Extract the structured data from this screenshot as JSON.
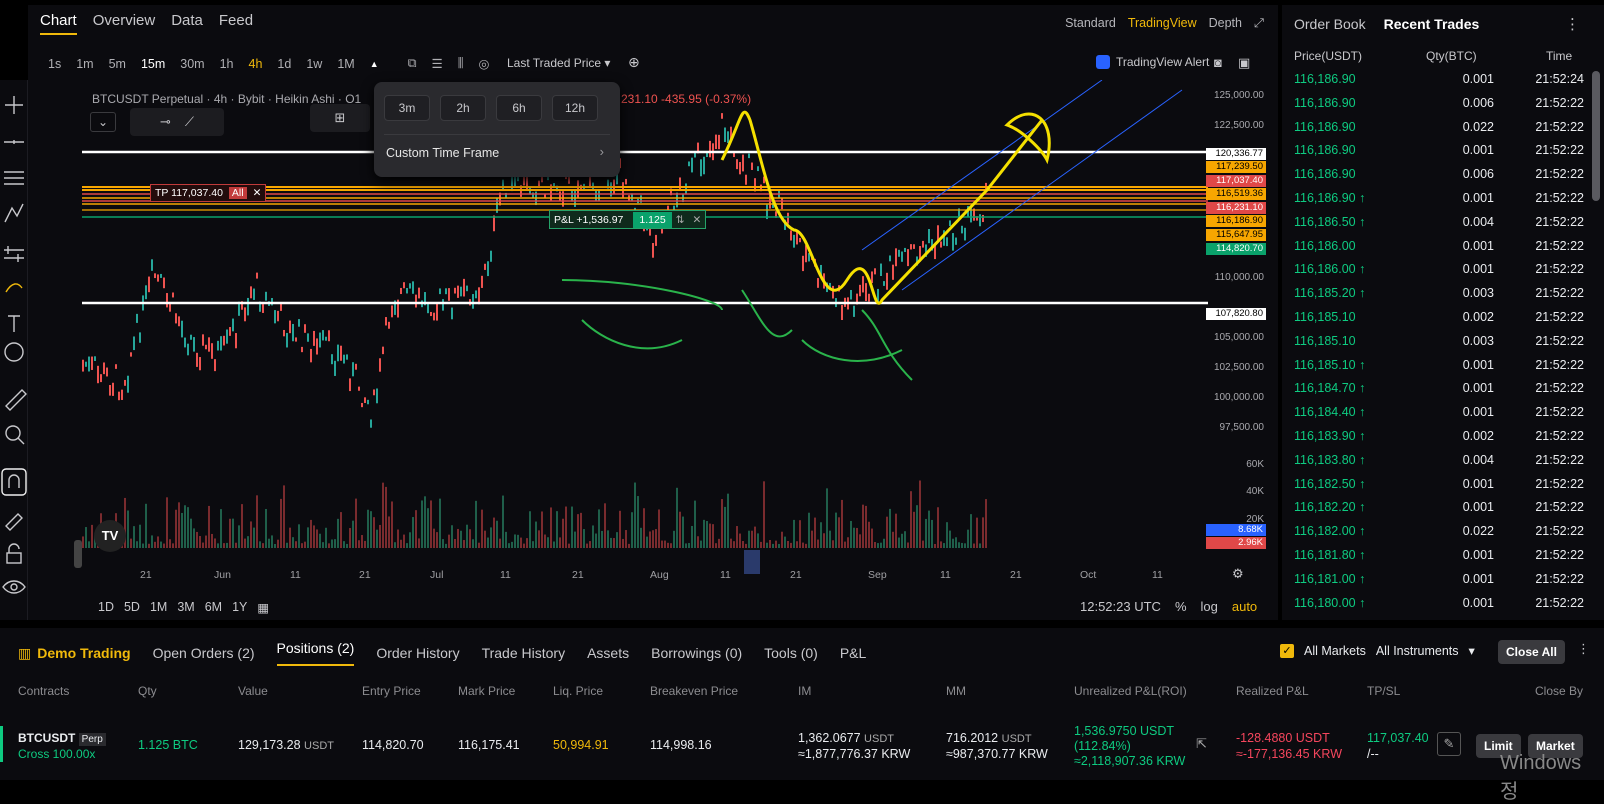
{
  "chart_tabs": [
    "Chart",
    "Overview",
    "Data",
    "Feed"
  ],
  "view_modes": [
    "Standard",
    "TradingView",
    "Depth"
  ],
  "timeframes": [
    "1s",
    "1m",
    "5m",
    "15m",
    "30m",
    "1h",
    "4h",
    "1d",
    "1w",
    "1M"
  ],
  "price_source": "Last Traded Price",
  "tv_alert": "TradingView Alert",
  "symbol_line": "BTCUSDT Perpetual · 4h · Bybit · Heikin Ashi · O1",
  "symbol_change": "231.10 -435.95 (-0.37%)",
  "tf_menu": {
    "options": [
      "3m",
      "2h",
      "6h",
      "12h"
    ],
    "custom": "Custom Time Frame"
  },
  "price_ticks": [
    "125,000.00",
    "122,500.00",
    "110,000.00",
    "105,000.00",
    "102,500.00",
    "100,000.00",
    "97,500.00",
    "60K",
    "40K",
    "20K"
  ],
  "price_badges": [
    {
      "v": "120,336.77",
      "c": "#ffffff"
    },
    {
      "v": "117,239.50",
      "c": "#f7a600"
    },
    {
      "v": "117,037.40",
      "c": "#e04848"
    },
    {
      "v": "116,519.36",
      "c": "#f7a600"
    },
    {
      "v": "116,231.10",
      "c": "#e04848"
    },
    {
      "v": "116,186.90",
      "c": "#f7a600"
    },
    {
      "v": "115,647.95",
      "c": "#f7a600"
    },
    {
      "v": "114,820.70",
      "c": "#0aa26b"
    },
    {
      "v": "107,820.80",
      "c": "#ffffff"
    }
  ],
  "volume_badges": [
    {
      "v": "8.68K",
      "c": "#2962ff"
    },
    {
      "v": "2.96K",
      "c": "#e04848"
    }
  ],
  "tp_label": "TP 117,037.40",
  "tp_all": "All",
  "pnl_label": "P&L +1,536.97",
  "pnl_qty": "1.125",
  "x_labels": [
    "21",
    "Jun",
    "11",
    "21",
    "Jul",
    "11",
    "21",
    "Aug",
    "11",
    "21",
    "Sep",
    "11",
    "21",
    "Oct",
    "11"
  ],
  "bottom_ranges": [
    "1D",
    "5D",
    "1M",
    "3M",
    "6M",
    "1Y"
  ],
  "clock": "12:52:23 UTC",
  "pct": "%",
  "log": "log",
  "auto": "auto",
  "right_tabs": [
    "Order Book",
    "Recent Trades"
  ],
  "trades_headers": [
    "Price(USDT)",
    "Qty(BTC)",
    "Time"
  ],
  "trades": [
    {
      "p": "116,186.90",
      "q": "0.001",
      "t": "21:52:24",
      "up": false
    },
    {
      "p": "116,186.90",
      "q": "0.006",
      "t": "21:52:22",
      "up": false
    },
    {
      "p": "116,186.90",
      "q": "0.022",
      "t": "21:52:22",
      "up": false
    },
    {
      "p": "116,186.90",
      "q": "0.001",
      "t": "21:52:22",
      "up": false
    },
    {
      "p": "116,186.90",
      "q": "0.006",
      "t": "21:52:22",
      "up": false
    },
    {
      "p": "116,186.90",
      "q": "0.001",
      "t": "21:52:22",
      "up": true
    },
    {
      "p": "116,186.50",
      "q": "0.004",
      "t": "21:52:22",
      "up": true
    },
    {
      "p": "116,186.00",
      "q": "0.001",
      "t": "21:52:22",
      "up": false
    },
    {
      "p": "116,186.00",
      "q": "0.001",
      "t": "21:52:22",
      "up": true
    },
    {
      "p": "116,185.20",
      "q": "0.003",
      "t": "21:52:22",
      "up": true
    },
    {
      "p": "116,185.10",
      "q": "0.002",
      "t": "21:52:22",
      "up": false
    },
    {
      "p": "116,185.10",
      "q": "0.003",
      "t": "21:52:22",
      "up": false
    },
    {
      "p": "116,185.10",
      "q": "0.001",
      "t": "21:52:22",
      "up": true
    },
    {
      "p": "116,184.70",
      "q": "0.001",
      "t": "21:52:22",
      "up": true
    },
    {
      "p": "116,184.40",
      "q": "0.001",
      "t": "21:52:22",
      "up": true
    },
    {
      "p": "116,183.90",
      "q": "0.002",
      "t": "21:52:22",
      "up": true
    },
    {
      "p": "116,183.80",
      "q": "0.004",
      "t": "21:52:22",
      "up": true
    },
    {
      "p": "116,182.50",
      "q": "0.001",
      "t": "21:52:22",
      "up": true
    },
    {
      "p": "116,182.20",
      "q": "0.001",
      "t": "21:52:22",
      "up": true
    },
    {
      "p": "116,182.00",
      "q": "0.022",
      "t": "21:52:22",
      "up": true
    },
    {
      "p": "116,181.80",
      "q": "0.001",
      "t": "21:52:22",
      "up": true
    },
    {
      "p": "116,181.00",
      "q": "0.001",
      "t": "21:52:22",
      "up": true
    },
    {
      "p": "116,180.00",
      "q": "0.001",
      "t": "21:52:22",
      "up": true
    }
  ],
  "bottom_tabs": {
    "demo": "Demo Trading",
    "tabs": [
      "Open Orders (2)",
      "Positions (2)",
      "Order History",
      "Trade History",
      "Assets",
      "Borrowings (0)",
      "Tools (0)",
      "P&L"
    ]
  },
  "all_markets": "All Markets",
  "all_instruments": "All Instruments",
  "close_all": "Close All",
  "pos_headers": [
    "Contracts",
    "Qty",
    "Value",
    "Entry Price",
    "Mark Price",
    "Liq. Price",
    "Breakeven Price",
    "IM",
    "MM",
    "Unrealized P&L(ROI)",
    "Realized P&L",
    "TP/SL",
    "Close By"
  ],
  "position": {
    "symbol": "BTCUSDT",
    "perp": "Perp",
    "cross": "Cross 100.00x",
    "qty": "1.125 BTC",
    "value": "129,173.28",
    "value_unit": "USDT",
    "entry": "114,820.70",
    "mark": "116,175.41",
    "liq": "50,994.91",
    "breakeven": "114,998.16",
    "im1": "1,362.0677",
    "im_unit": "USDT",
    "im2": "≈1,877,776.37 KRW",
    "mm1": "716.2012",
    "mm2": "≈987,370.77 KRW",
    "upnl1": "1,536.9750 USDT",
    "upnl2": "(112.84%)",
    "upnl3": "≈2,118,907.36 KRW",
    "rpnl1": "-128.4880 USDT",
    "rpnl2": "≈-177,136.45 KRW",
    "tp": "117,037.40",
    "sl": "/--",
    "limit": "Limit",
    "market": "Market"
  },
  "watermark": "Windows 정"
}
